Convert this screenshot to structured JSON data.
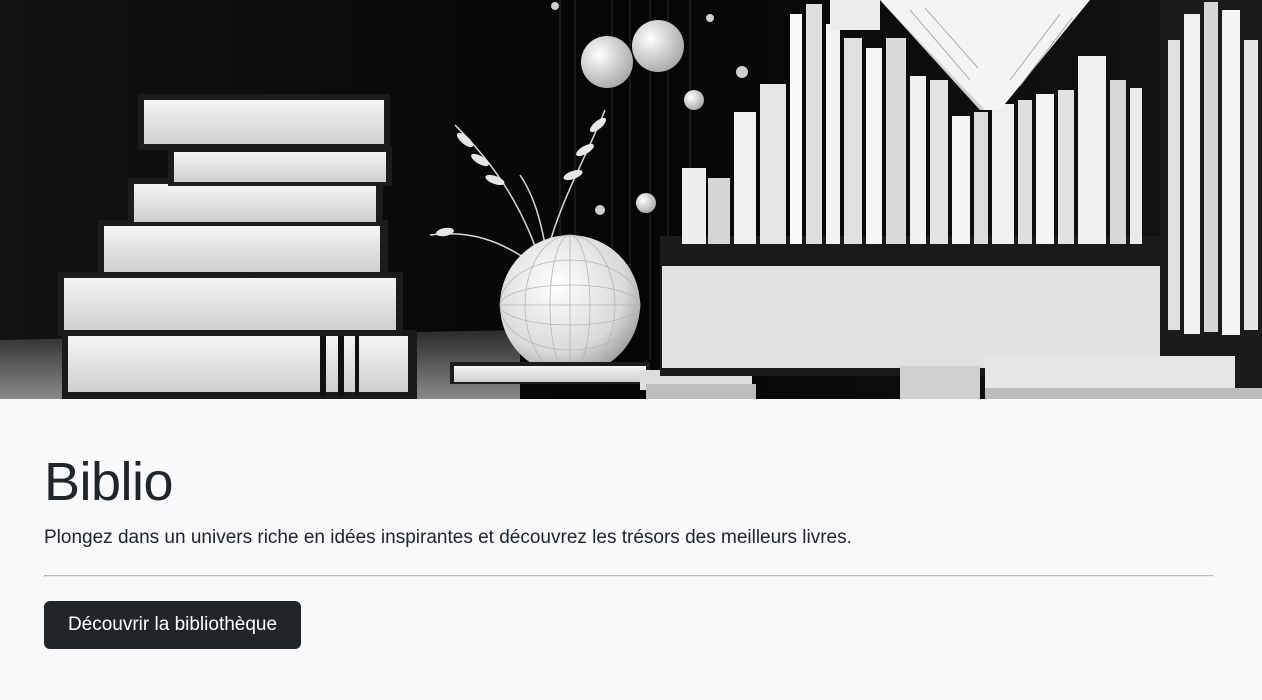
{
  "hero": {
    "alt": "Illustration en noir et blanc de livres, d'un globe et d'étagères"
  },
  "jumbotron": {
    "title": "Biblio",
    "lead": "Plongez dans un univers riche en idées inspirantes et découvrez les trésors des meilleurs livres.",
    "cta_label": "Découvrir la bibliothèque"
  },
  "colors": {
    "page_background": "#f8f9fa",
    "button_background": "#212529",
    "button_text": "#ffffff",
    "text": "#212529"
  }
}
